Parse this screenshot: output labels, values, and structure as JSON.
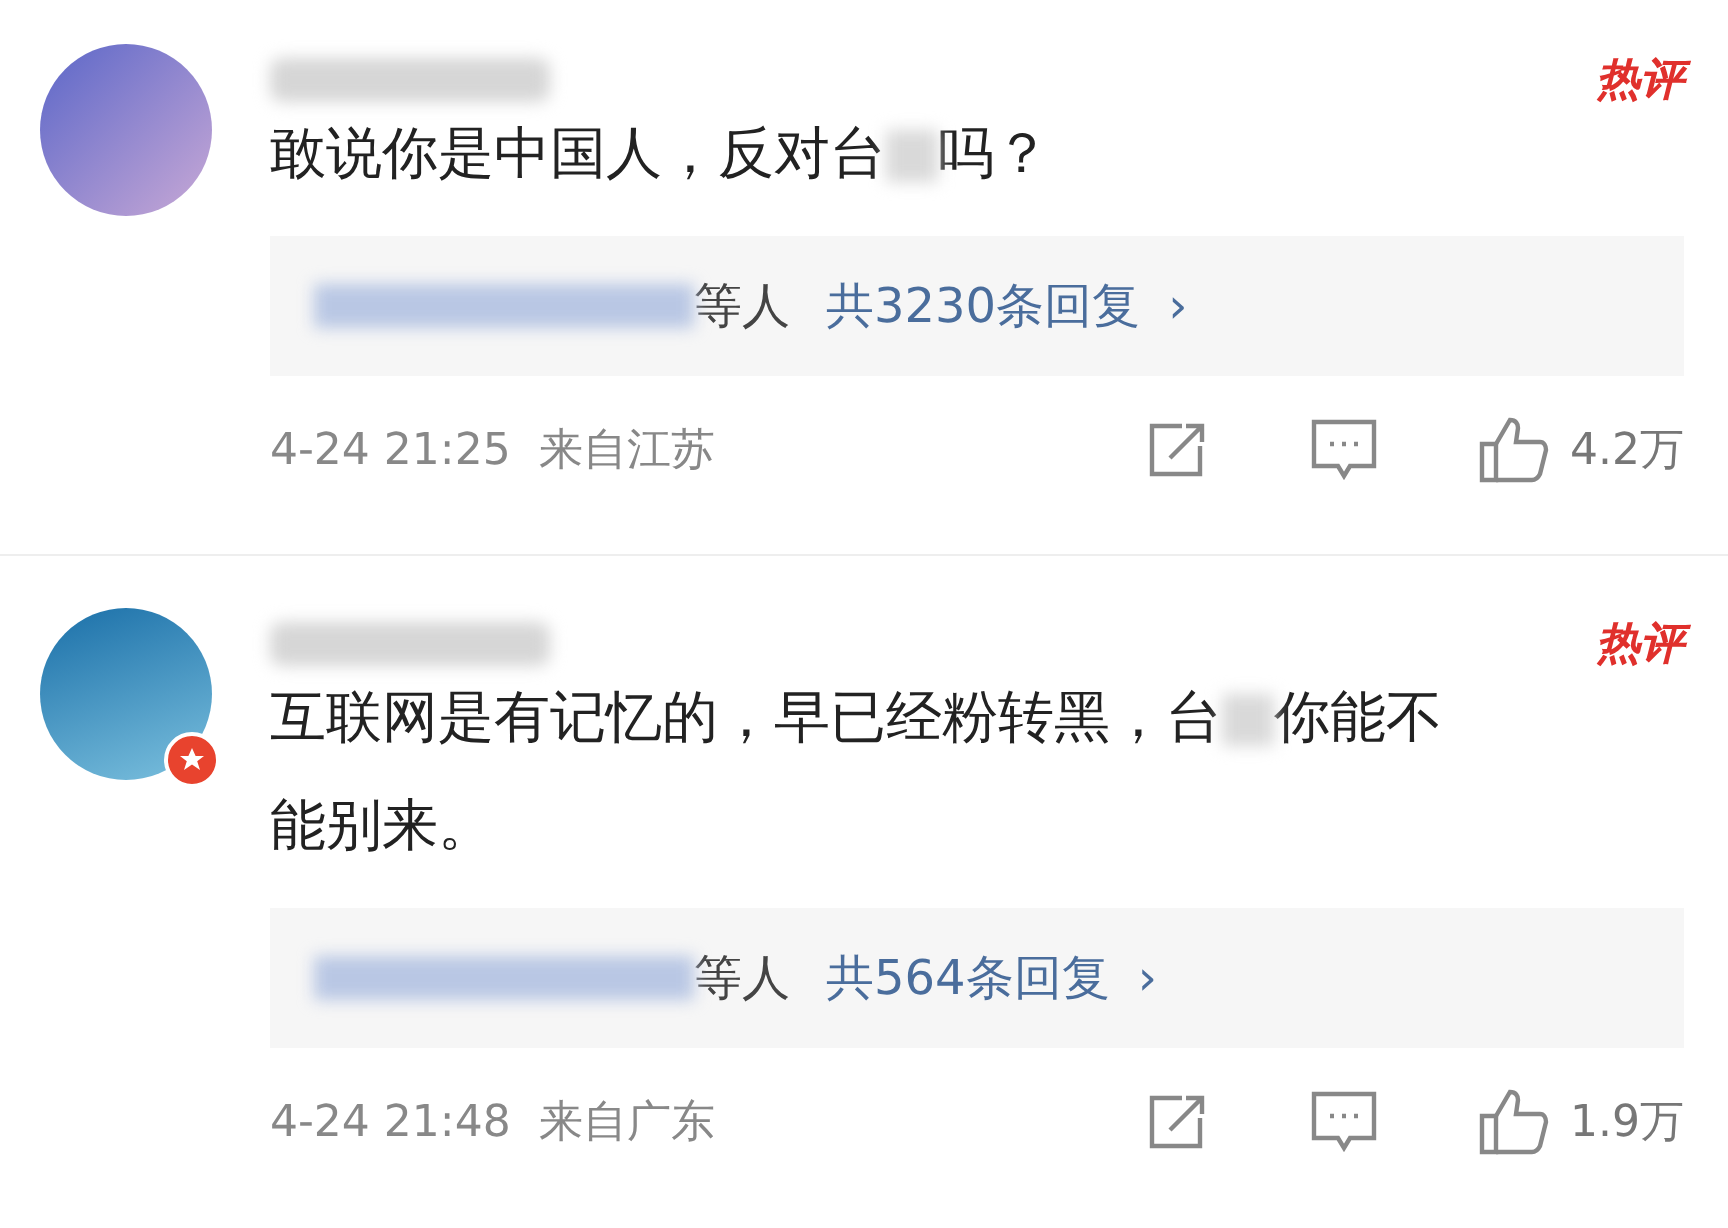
{
  "comments": [
    {
      "verified": false,
      "hot_tag": "热评",
      "text_lines": [
        [
          "敢说你是中国人，反对台",
          "吗？"
        ]
      ],
      "reply_suffix": "等人",
      "reply_count": "共3230条回复",
      "reply_arrow": "›",
      "time": "4-24 21:25",
      "location": "来自江苏",
      "likes": "4.2万"
    },
    {
      "verified": true,
      "hot_tag": "热评",
      "text_lines": [
        [
          "互联网是有记忆的，早已经粉转黑，台",
          "你能不"
        ],
        [
          "能别来。"
        ]
      ],
      "reply_suffix": "等人",
      "reply_count": "共564条回复",
      "reply_arrow": "›",
      "time": "4-24 21:48",
      "location": "来自广东",
      "likes": "1.9万"
    }
  ]
}
